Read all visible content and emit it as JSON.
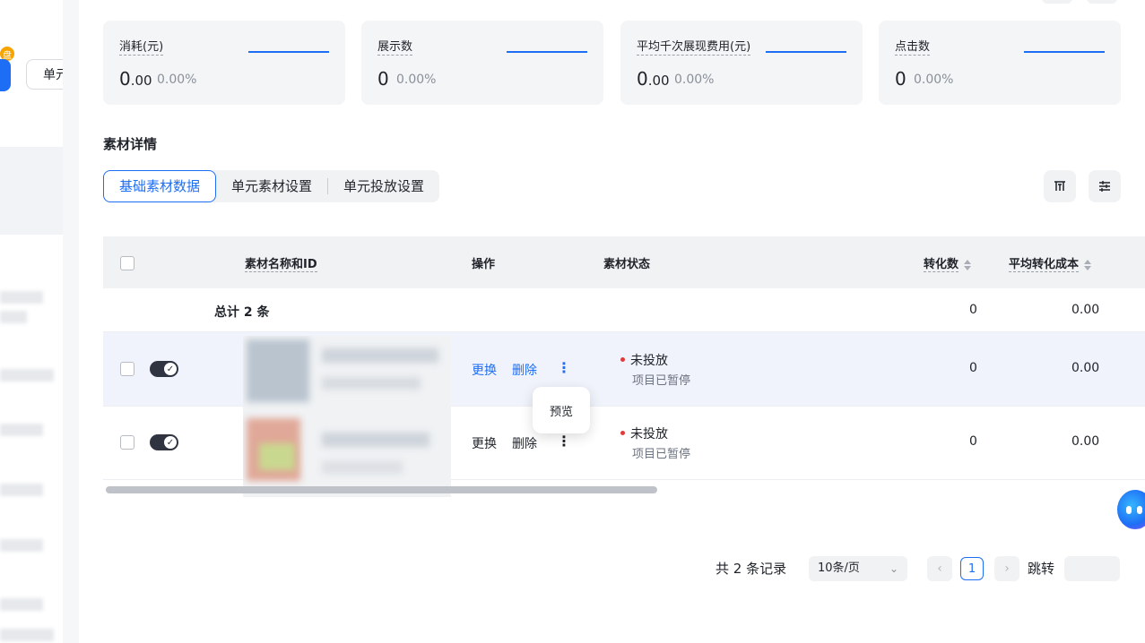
{
  "left_panel": {
    "badge": "盘",
    "unit_button": "单元"
  },
  "metrics": [
    {
      "label": "消耗(元)",
      "value_main": "0",
      "value_decimal": ".00",
      "change": "0.00%"
    },
    {
      "label": "展示数",
      "value_main": "0",
      "value_decimal": "",
      "change": "0.00%"
    },
    {
      "label": "平均千次展现费用(元)",
      "value_main": "0",
      "value_decimal": ".00",
      "change": "0.00%"
    },
    {
      "label": "点击数",
      "value_main": "0",
      "value_decimal": "",
      "change": "0.00%"
    }
  ],
  "section_title": "素材详情",
  "tabs": [
    "基础素材数据",
    "单元素材设置",
    "单元投放设置"
  ],
  "toolbar": {
    "columns_icon": "column-settings-icon",
    "filter_icon": "sliders-icon"
  },
  "table": {
    "headers": {
      "name": "素材名称和ID",
      "actions": "操作",
      "status": "素材状态",
      "conversions": "转化数",
      "avg_cost": "平均转化成本"
    },
    "total": {
      "label": "总计 2 条",
      "conversions": "0",
      "avg_cost": "0.00"
    },
    "rows": [
      {
        "replace": "更换",
        "delete": "删除",
        "status": "未投放",
        "status_sub": "项目已暂停",
        "conversions": "0",
        "avg_cost": "0.00"
      },
      {
        "replace": "更换",
        "delete": "删除",
        "status": "未投放",
        "status_sub": "项目已暂停",
        "conversions": "0",
        "avg_cost": "0.00"
      }
    ],
    "popover": "预览"
  },
  "pagination": {
    "total_text": "共 2 条记录",
    "page_size": "10条/页",
    "current_page": "1",
    "prev": "‹",
    "next": "›",
    "jump_label": "跳转"
  },
  "colors": {
    "accent": "#1e6ef5",
    "status_red": "#e03b3b"
  }
}
